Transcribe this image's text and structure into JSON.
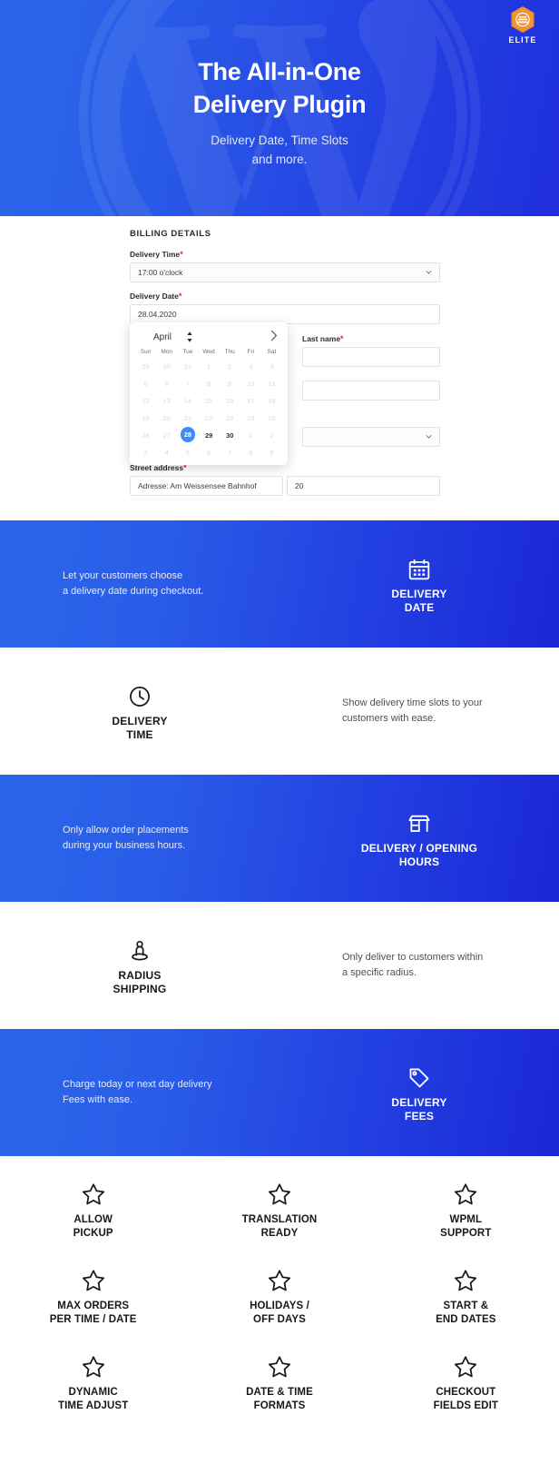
{
  "hero": {
    "badge": {
      "icon": "elite-hexagon-badge-icon",
      "label": "ELITE"
    },
    "title_line1": "The All-in-One",
    "title_line2": "Delivery Plugin",
    "subtitle_line1": "Delivery Date, Time Slots",
    "subtitle_line2": "and more.",
    "watermark": "wordpress-w-icon",
    "gradient_from": "#2b66ea",
    "gradient_to": "#1f2fdc"
  },
  "checkout": {
    "section_title": "BILLING DETAILS",
    "required_mark": "*",
    "fields": [
      {
        "label": "Delivery Time",
        "value": "17:00 o'clock",
        "type": "select",
        "required": true
      },
      {
        "label": "Delivery Date",
        "value": "28.04.2020",
        "type": "text",
        "required": true
      },
      {
        "label": "Last name",
        "value": "",
        "type": "text",
        "required": true
      },
      {
        "label": "Street address",
        "value": "Adresse: Am Weissensee Bahnhof",
        "value2": "20",
        "type": "text",
        "required": true
      }
    ],
    "datepicker": {
      "month": "April",
      "stepper_icon": "stepper-up-down-icon",
      "next_icon": "chevron-right-icon",
      "weekdays": [
        "Sun",
        "Mon",
        "Tue",
        "Wed",
        "Thu",
        "Fri",
        "Sat"
      ],
      "selected": 28,
      "accent": "#3d8bfd",
      "weeks": [
        [
          {
            "d": "29",
            "s": "off"
          },
          {
            "d": "30",
            "s": "off"
          },
          {
            "d": "31",
            "s": "off"
          },
          {
            "d": "1",
            "s": "off"
          },
          {
            "d": "2",
            "s": "off"
          },
          {
            "d": "3",
            "s": "off"
          },
          {
            "d": "4",
            "s": "off"
          }
        ],
        [
          {
            "d": "5",
            "s": "off"
          },
          {
            "d": "6",
            "s": "off"
          },
          {
            "d": "7",
            "s": "off"
          },
          {
            "d": "8",
            "s": "off"
          },
          {
            "d": "9",
            "s": "off"
          },
          {
            "d": "10",
            "s": "off"
          },
          {
            "d": "11",
            "s": "off"
          }
        ],
        [
          {
            "d": "12",
            "s": "off"
          },
          {
            "d": "13",
            "s": "off"
          },
          {
            "d": "14",
            "s": "off"
          },
          {
            "d": "15",
            "s": "off"
          },
          {
            "d": "16",
            "s": "off"
          },
          {
            "d": "17",
            "s": "off"
          },
          {
            "d": "18",
            "s": "off"
          }
        ],
        [
          {
            "d": "19",
            "s": "off"
          },
          {
            "d": "20",
            "s": "off"
          },
          {
            "d": "21",
            "s": "off"
          },
          {
            "d": "22",
            "s": "off"
          },
          {
            "d": "23",
            "s": "off"
          },
          {
            "d": "24",
            "s": "off"
          },
          {
            "d": "25",
            "s": "off"
          }
        ],
        [
          {
            "d": "26",
            "s": "off"
          },
          {
            "d": "27",
            "s": "off"
          },
          {
            "d": "28",
            "s": "sel"
          },
          {
            "d": "29",
            "s": "on"
          },
          {
            "d": "30",
            "s": "on"
          },
          {
            "d": "1",
            "s": "off"
          },
          {
            "d": "2",
            "s": "off"
          }
        ],
        [
          {
            "d": "3",
            "s": "off"
          },
          {
            "d": "4",
            "s": "off"
          },
          {
            "d": "5",
            "s": "off"
          },
          {
            "d": "6",
            "s": "off"
          },
          {
            "d": "7",
            "s": "off"
          },
          {
            "d": "8",
            "s": "off"
          },
          {
            "d": "9",
            "s": "off"
          }
        ]
      ]
    }
  },
  "bands": [
    {
      "theme": "blue",
      "icon": "calendar-icon",
      "title_line1": "DELIVERY",
      "title_line2": "DATE",
      "text_line1": "Let your customers choose",
      "text_line2": "a delivery date during checkout.",
      "icon_side": "right"
    },
    {
      "theme": "white",
      "icon": "clock-icon",
      "title_line1": "DELIVERY",
      "title_line2": "TIME",
      "text_line1": "Show delivery time slots to your",
      "text_line2": "customers with ease.",
      "icon_side": "left"
    },
    {
      "theme": "blue",
      "icon": "storefront-icon",
      "title_line1": "DELIVERY / OPENING",
      "title_line2": "HOURS",
      "text_line1": "Only allow order placements",
      "text_line2": "during your business hours.",
      "icon_side": "right"
    },
    {
      "theme": "white",
      "icon": "map-pin-person-icon",
      "title_line1": "RADIUS",
      "title_line2": "SHIPPING",
      "text_line1": "Only deliver to customers within",
      "text_line2": "a specific radius.",
      "icon_side": "left"
    },
    {
      "theme": "blue",
      "icon": "price-tag-icon",
      "title_line1": "DELIVERY",
      "title_line2": "FEES",
      "text_line1": "Charge today or next day delivery",
      "text_line2": "Fees with ease.",
      "icon_side": "right"
    }
  ],
  "star_features": [
    {
      "icon": "star-icon",
      "line1": "ALLOW",
      "line2": "PICKUP"
    },
    {
      "icon": "star-icon",
      "line1": "TRANSLATION",
      "line2": "READY"
    },
    {
      "icon": "star-icon",
      "line1": "WPML",
      "line2": "SUPPORT"
    },
    {
      "icon": "star-icon",
      "line1": "MAX ORDERS",
      "line2": "PER TIME / DATE"
    },
    {
      "icon": "star-icon",
      "line1": "HOLIDAYS /",
      "line2": "OFF DAYS"
    },
    {
      "icon": "star-icon",
      "line1": "START &",
      "line2": "END DATES"
    },
    {
      "icon": "star-icon",
      "line1": "DYNAMIC",
      "line2": "TIME ADJUST"
    },
    {
      "icon": "star-icon",
      "line1": "DATE & TIME",
      "line2": "FORMATS"
    },
    {
      "icon": "star-icon",
      "line1": "CHECKOUT",
      "line2": "FIELDS EDIT"
    }
  ]
}
